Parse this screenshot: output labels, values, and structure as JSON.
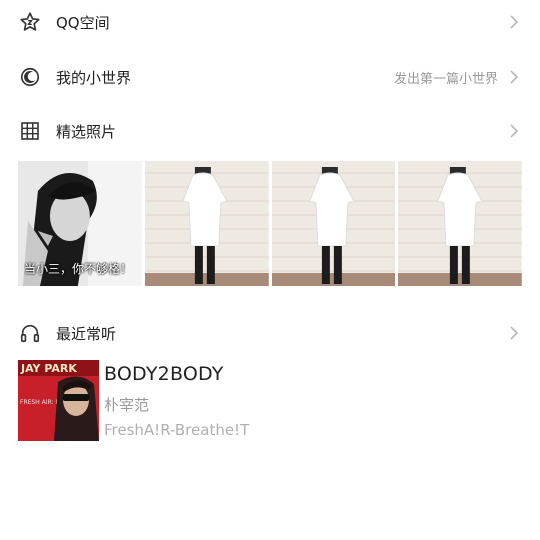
{
  "rows": {
    "qzone": {
      "label": "QQ空间",
      "icon": "star-icon"
    },
    "world": {
      "label": "我的小世界",
      "extra": "发出第一篇小世界",
      "icon": "moon-icon"
    },
    "photos": {
      "label": "精选照片",
      "icon": "grid-icon"
    },
    "recent": {
      "label": "最近常听",
      "icon": "headphones-icon"
    }
  },
  "photos": [
    {
      "caption": "当小三，你不够格！"
    },
    {
      "caption": ""
    },
    {
      "caption": ""
    },
    {
      "caption": ""
    }
  ],
  "recent_song": {
    "title": "BODY2BODY",
    "artist": "朴宰范",
    "album": "FreshA!R-Breathe!T",
    "cover_text": "JAY PARK",
    "cover_subtext": "FRESH AIR: BREATHE IT"
  },
  "colors": {
    "primary_text": "#222222",
    "secondary_text": "#9a9a9a",
    "icon": "#333333",
    "chevron": "#b8b8b8"
  }
}
